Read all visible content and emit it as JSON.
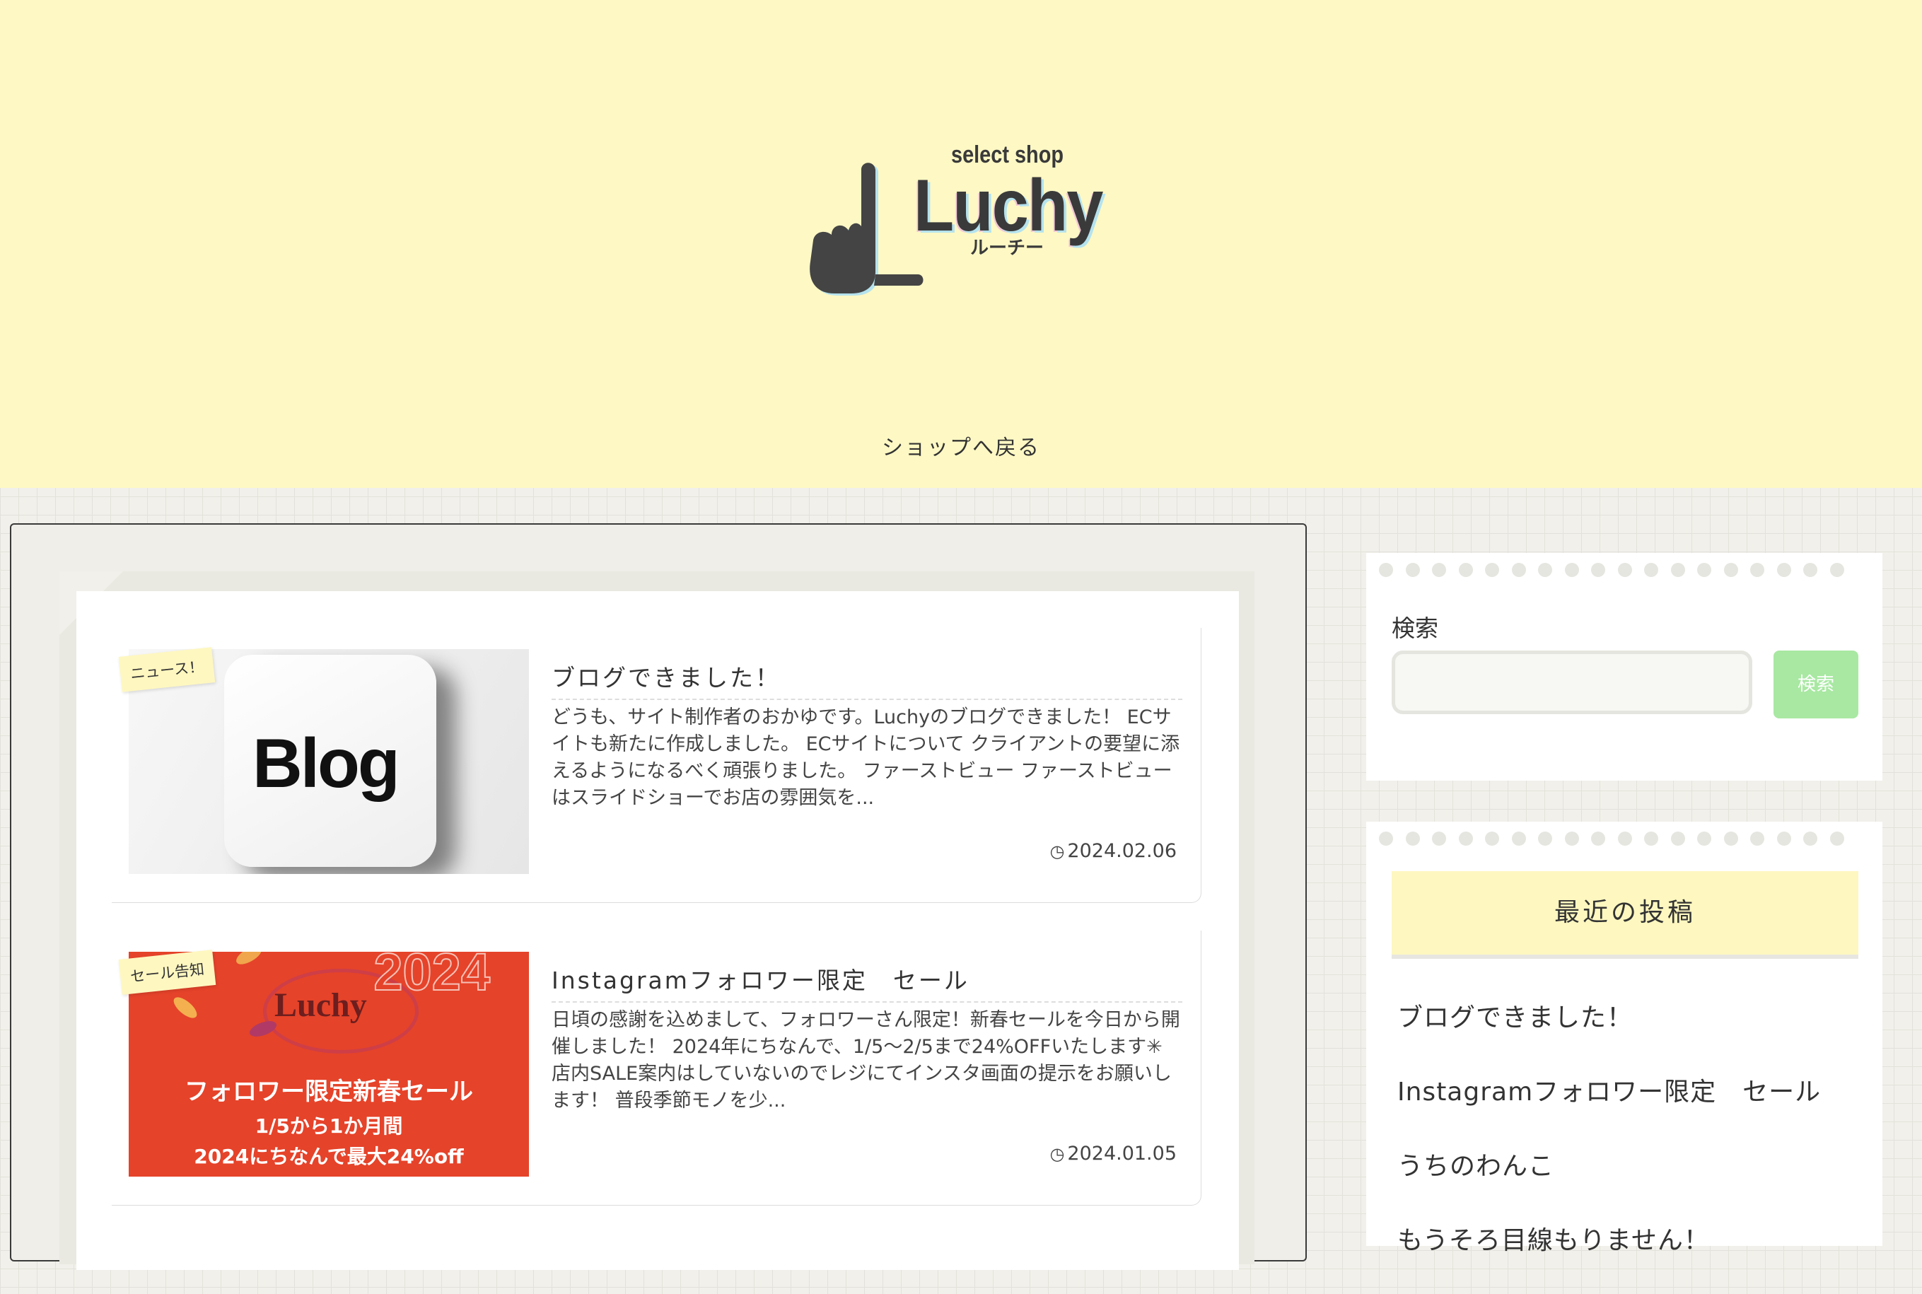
{
  "header": {
    "logo": {
      "tagline": "select shop",
      "name": "Luchy",
      "kana": "ルーチー"
    },
    "nav_link": "ショップへ戻る"
  },
  "posts": [
    {
      "badge": "ニュース！",
      "thumb_text": "Blog",
      "title": "ブログできました！",
      "excerpt": "どうも、サイト制作者のおかゆです。Luchyのブログできました！ ECサイトも新たに作成しました。 ECサイトについて クライアントの要望に添えるようになるべく頑張りました。 ファーストビュー ファーストビューはスライドショーでお店の雰囲気を...",
      "date": "2024.02.06"
    },
    {
      "badge": "セール告知",
      "thumb": {
        "year": "2024",
        "brand": "Luchy",
        "line1": "フォロワー限定新春セール",
        "line2": "1/5から1か月間",
        "line3": "2024にちなんで最大24%off"
      },
      "title": "Instagramフォロワー限定　セール",
      "excerpt": "日頃の感謝を込めまして、フォロワーさん限定！新春セールを今日から開催しました！ 2024年にちなんで、1/5〜2/5まで24%OFFいたします✳︎ 店内SALE案内はしていないのでレジにてインスタ画面の提示をお願いします！ 普段季節モノを少...",
      "date": "2024.01.05"
    }
  ],
  "sidebar": {
    "search": {
      "label": "検索",
      "button": "検索",
      "value": ""
    },
    "recent": {
      "heading": "最近の投稿",
      "items": [
        "ブログできました！",
        "Instagramフォロワー限定　セール",
        "うちのわんこ",
        "もうそろ目線もりません！"
      ]
    }
  },
  "colors": {
    "header_bg": "#fef8c4",
    "badge_bg": "#fef7c0",
    "search_button": "#a8e8a2",
    "sale_red": "#e5432a"
  },
  "icons": {
    "date": "clock-icon"
  }
}
